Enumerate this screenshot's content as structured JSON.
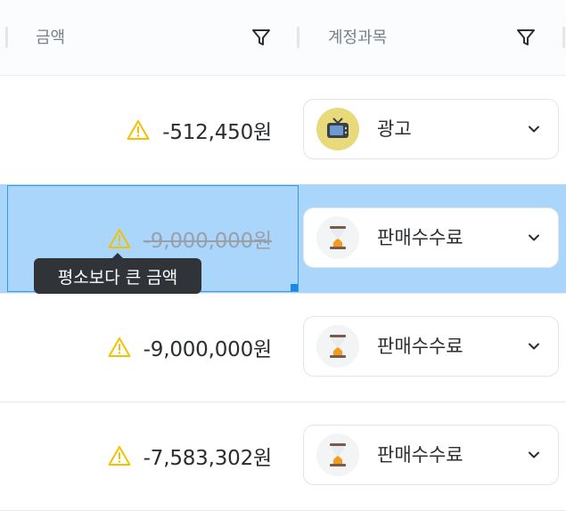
{
  "header": {
    "amount_label": "금액",
    "account_label": "계정과목"
  },
  "rows": [
    {
      "amount": "-512,450원",
      "category": "광고",
      "icon": "tv-icon",
      "warning": true,
      "strike": false
    },
    {
      "amount": "-9,000,000원",
      "category": "판매수수료",
      "icon": "hourglass-icon",
      "warning": true,
      "strike": true,
      "selected": true
    },
    {
      "amount": "-9,000,000원",
      "category": "판매수수료",
      "icon": "hourglass-icon",
      "warning": true,
      "strike": false
    },
    {
      "amount": "-7,583,302원",
      "category": "판매수수료",
      "icon": "hourglass-icon",
      "warning": true,
      "strike": false
    }
  ],
  "tooltip": {
    "text": "평소보다 큰 금액"
  },
  "colors": {
    "selection": "#aad6fb",
    "selection_border": "#3b96ea",
    "warning": "#f2c200",
    "tooltip_bg": "#303338"
  }
}
